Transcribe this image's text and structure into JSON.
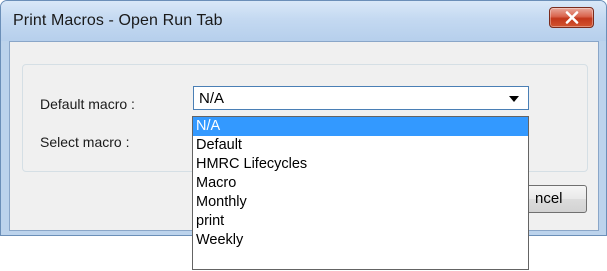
{
  "window": {
    "title": "Print Macros - Open Run Tab",
    "close_icon": "close-x-icon"
  },
  "form": {
    "default_macro_label": "Default macro :",
    "select_macro_label": "Select macro :",
    "default_macro_value": "N/A"
  },
  "buttons": {
    "cancel_label": "ncel"
  },
  "dropdown": {
    "selected_index": 0,
    "items": [
      "N/A",
      "Default",
      "HMRC Lifecycles",
      "Macro",
      "Monthly",
      "print",
      "Weekly"
    ]
  },
  "colors": {
    "selection": "#3399ff",
    "close_button": "#c2371c",
    "title_bar": "#c4d9f1"
  }
}
